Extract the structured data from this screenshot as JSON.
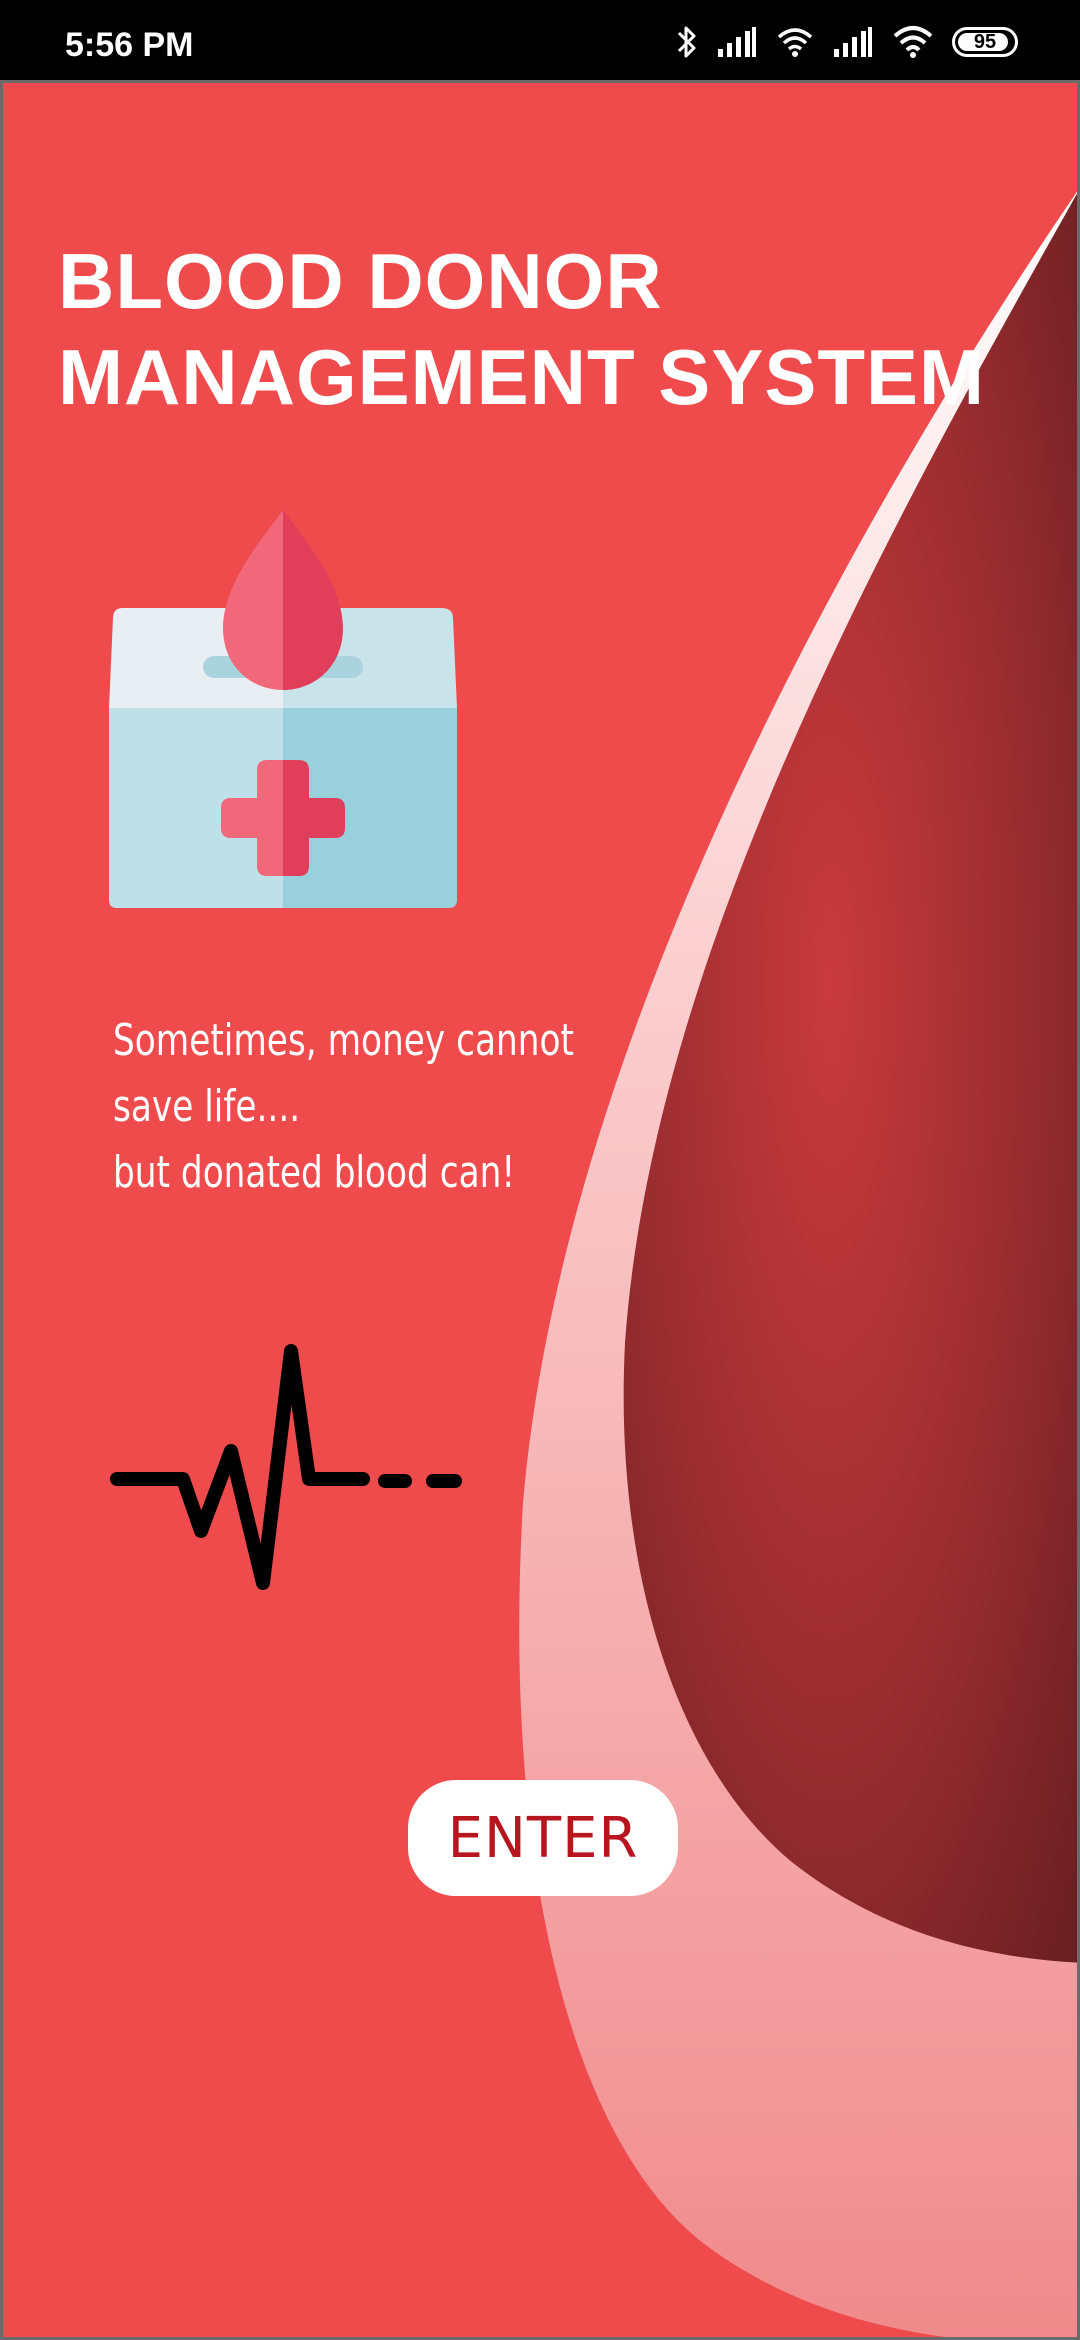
{
  "status_bar": {
    "time": "5:56 PM",
    "battery_level": "95",
    "icons": [
      "bluetooth-icon",
      "signal-icon",
      "wifi-icon",
      "signal-icon",
      "wifi-icon",
      "battery-icon"
    ]
  },
  "splash": {
    "title_line1": "BLOOD DONOR",
    "title_line2": "MANAGEMENT SYSTEM",
    "illustration": "blood-donation-box-icon",
    "tagline_line1": "Sometimes, money cannot",
    "tagline_line2": "save life....",
    "tagline_line3": "but donated blood can!",
    "pulse_icon": "heartbeat-icon",
    "enter_label": "ENTER"
  },
  "colors": {
    "background": "#f04b4c",
    "drop_dark": "#7a2226",
    "drop_light": "#f5a3a4",
    "button_text": "#b8161f",
    "title_text": "#ffffff"
  }
}
